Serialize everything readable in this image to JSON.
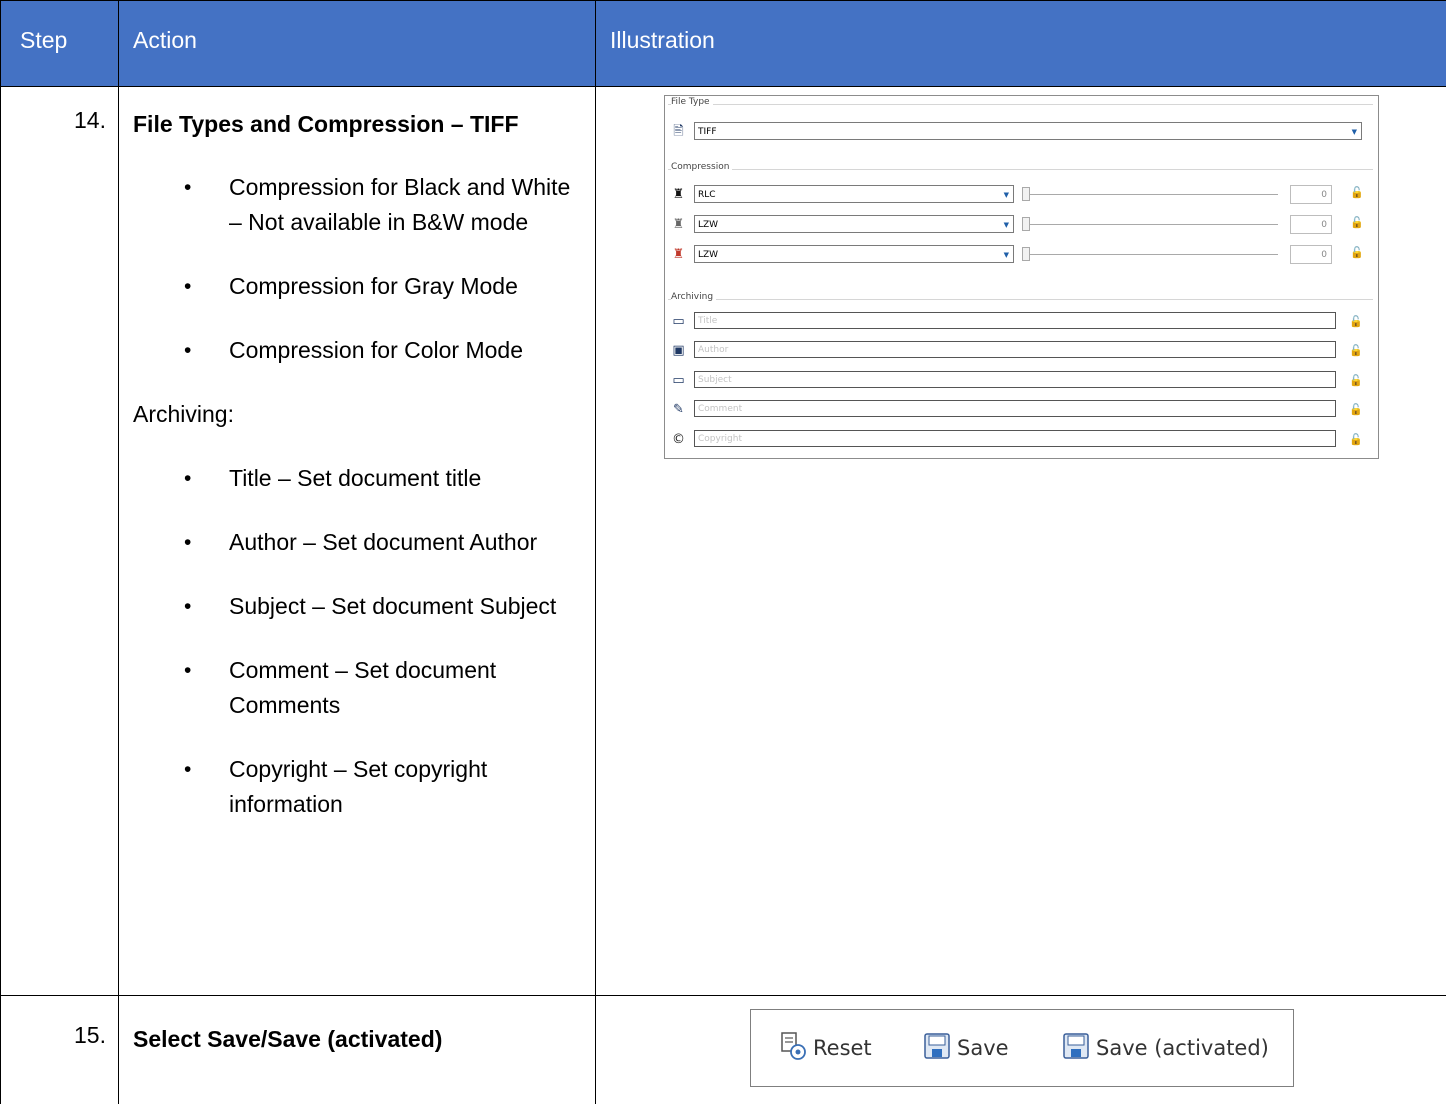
{
  "table": {
    "headers": {
      "step": "Step",
      "action": "Action",
      "illustration": "Illustration"
    },
    "rows": [
      {
        "step": "14.",
        "title": "File Types and Compression – TIFF",
        "bullets_a": [
          "Compression for Black and White – Not available in B&W mode",
          "Compression for Gray Mode",
          "Compression for Color Mode"
        ],
        "subheading": "Archiving:",
        "bullets_b": [
          "Title – Set document title",
          "Author – Set document Author",
          "Subject – Set document Subject",
          "Comment – Set document Comments",
          "Copyright – Set copyright information"
        ]
      },
      {
        "step": "15.",
        "title": "Select Save/Save (activated)"
      }
    ]
  },
  "panel": {
    "file_type_label": "File Type",
    "file_type_value": "TIFF",
    "compression_label": "Compression",
    "compression_rows": [
      {
        "mode": "black-white",
        "value": "RLC",
        "level": "0"
      },
      {
        "mode": "gray",
        "value": "LZW",
        "level": "0"
      },
      {
        "mode": "color",
        "value": "LZW",
        "level": "0"
      }
    ],
    "archiving_label": "Archiving",
    "archiving_fields": [
      {
        "icon": "title-icon",
        "placeholder": "Title"
      },
      {
        "icon": "author-icon",
        "placeholder": "Author"
      },
      {
        "icon": "subject-icon",
        "placeholder": "Subject"
      },
      {
        "icon": "comment-icon",
        "placeholder": "Comment"
      },
      {
        "icon": "copyright-icon",
        "placeholder": "Copyright"
      }
    ]
  },
  "toolbar": {
    "reset_label": "Reset",
    "save_label": "Save",
    "save_activated_label": "Save (activated)"
  },
  "colors": {
    "header_bg": "#4472c4",
    "header_text": "#ffffff"
  }
}
